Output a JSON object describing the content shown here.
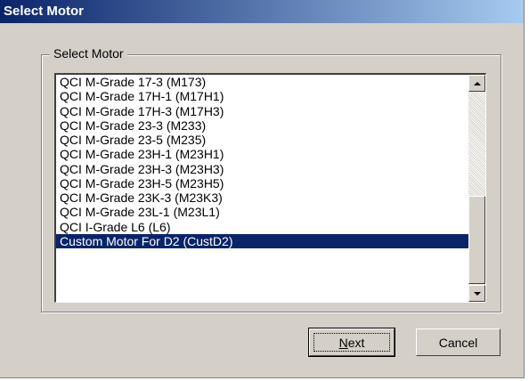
{
  "window": {
    "title": "Select Motor"
  },
  "group": {
    "label": "Select Motor"
  },
  "motor_list": {
    "items": [
      "QCI M-Grade 17-3 (M173)",
      "QCI M-Grade 17H-1 (M17H1)",
      "QCI M-Grade 17H-3 (M17H3)",
      "QCI M-Grade 23-3 (M233)",
      "QCI M-Grade 23-5 (M235)",
      "QCI M-Grade 23H-1 (M23H1)",
      "QCI M-Grade 23H-3 (M23H3)",
      "QCI M-Grade 23H-5 (M23H5)",
      "QCI M-Grade 23K-3 (M23K3)",
      "QCI M-Grade 23L-1 (M23L1)",
      "QCI I-Grade L6 (L6)",
      "Custom Motor For D2 (CustD2)"
    ],
    "selected_index": 11
  },
  "buttons": {
    "next_mnemonic": "N",
    "next_rest": "ext",
    "cancel": "Cancel"
  },
  "colors": {
    "selection": "#0a246a",
    "face": "#d4d0c8"
  }
}
